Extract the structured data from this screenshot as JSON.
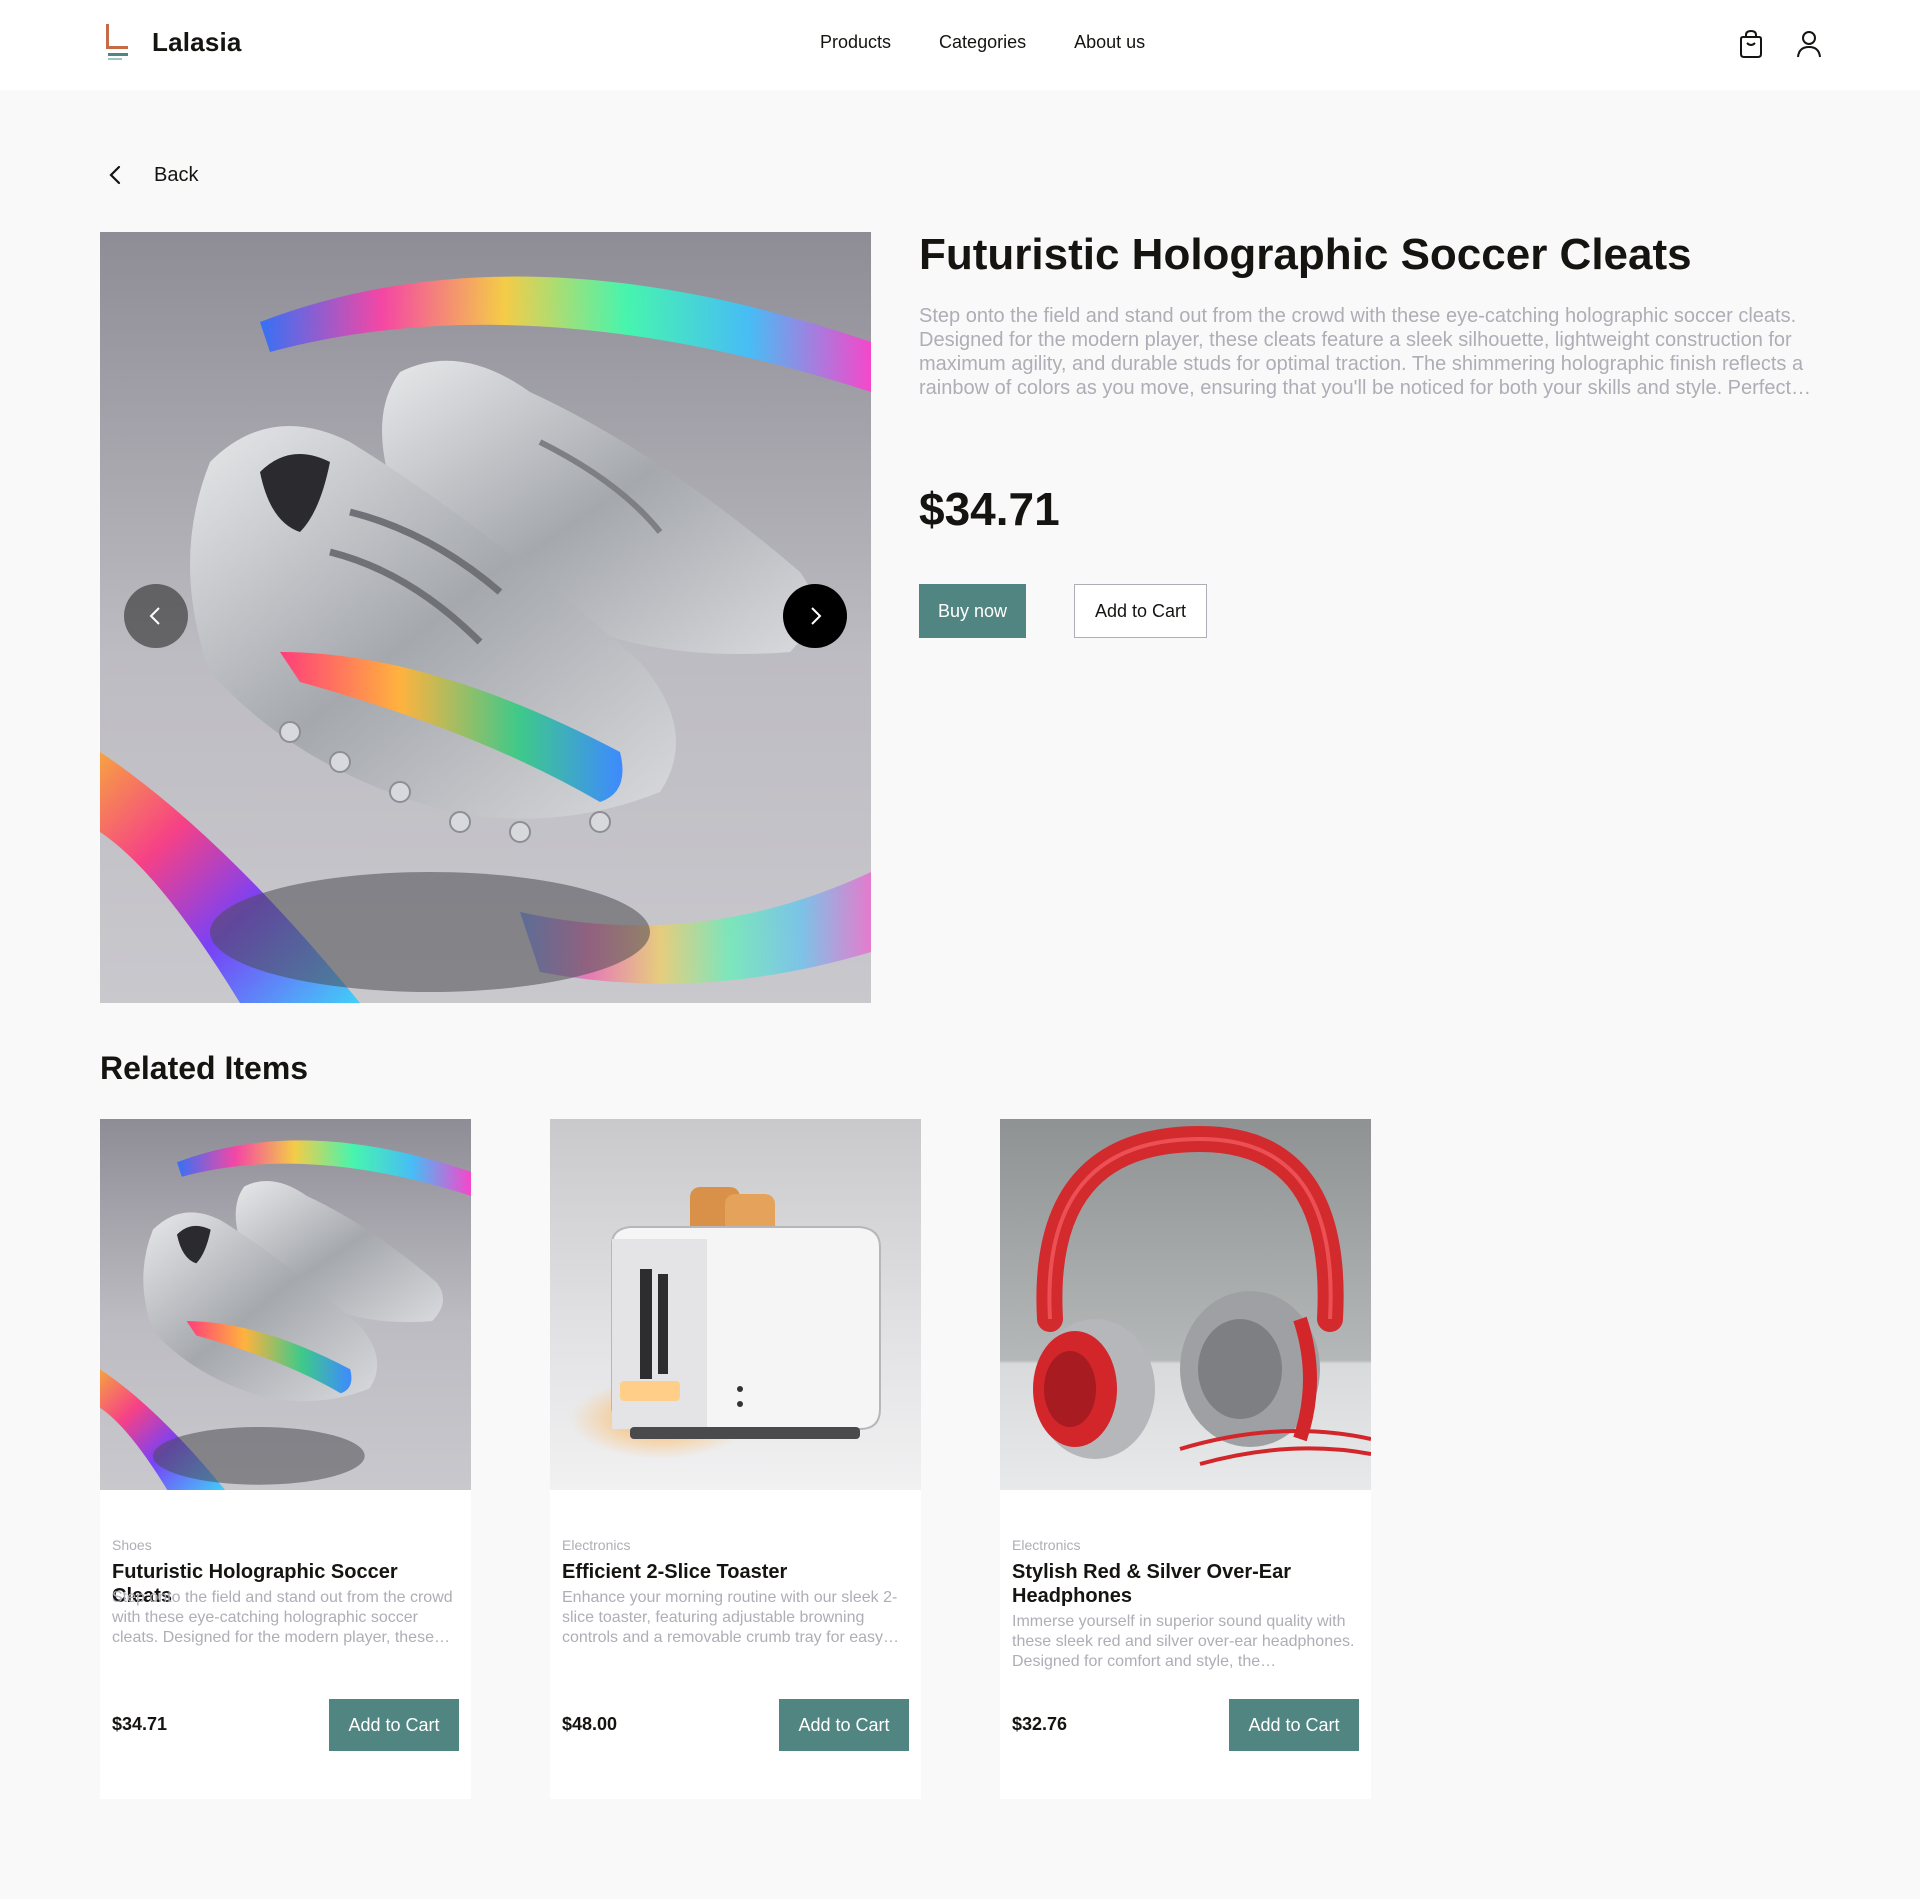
{
  "brand": {
    "name": "Lalasia"
  },
  "nav": {
    "items": [
      {
        "label": "Products"
      },
      {
        "label": "Categories"
      },
      {
        "label": "About us"
      }
    ]
  },
  "header_icons": [
    "cart-icon",
    "user-icon"
  ],
  "back": {
    "label": "Back"
  },
  "product": {
    "title": "Futuristic Holographic Soccer Cleats",
    "description": "Step onto the field and stand out from the crowd with these eye-catching holographic soccer cleats. Designed for the modern player, these cleats feature a sleek silhouette, lightweight construction for maximum agility, and durable studs for optimal traction. The shimmering holographic finish reflects a rainbow of colors as you move, ensuring that you'll be noticed for both your skills and style. Perfect…",
    "price": "$34.71",
    "buy_label": "Buy now",
    "add_label": "Add to Cart"
  },
  "related": {
    "title": "Related Items",
    "items": [
      {
        "category": "Shoes",
        "title": "Futuristic Holographic Soccer Cleats",
        "description": "Step onto the field and stand out from the crowd with these eye-catching holographic soccer cleats. Designed for the modern player, these…",
        "price": "$34.71",
        "button": "Add to Cart"
      },
      {
        "category": "Electronics",
        "title": "Efficient 2-Slice Toaster",
        "description": "Enhance your morning routine with our sleek 2-slice toaster, featuring adjustable browning controls and a removable crumb tray for easy…",
        "price": "$48.00",
        "button": "Add to Cart"
      },
      {
        "category": "Electronics",
        "title": "Stylish Red & Silver Over-Ear Headphones",
        "description": "Immerse yourself in superior sound quality with these sleek red and silver over-ear headphones. Designed for comfort and style, the headphone…",
        "price": "$32.76",
        "button": "Add to Cart"
      }
    ]
  },
  "colors": {
    "accent": "#518581",
    "text": "#151411",
    "muted": "#afadb5",
    "background": "#f9f9f9"
  }
}
